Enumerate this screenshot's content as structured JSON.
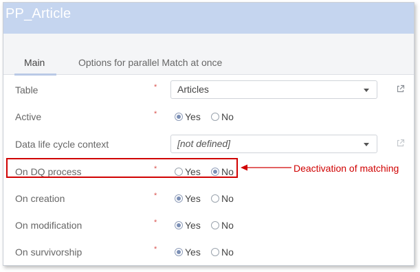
{
  "window": {
    "title": "PP_Article"
  },
  "tabs": [
    {
      "label": "Main",
      "active": true
    },
    {
      "label": "Options for parallel Match at once",
      "active": false
    }
  ],
  "required_marker": "*",
  "fields": {
    "table": {
      "label": "Table",
      "value": "Articles",
      "icon": "external-link-icon"
    },
    "active": {
      "label": "Active",
      "yes": "Yes",
      "no": "No",
      "selected": "Yes"
    },
    "dlc_context": {
      "label": "Data life cycle context",
      "value": "[not defined]",
      "icon": "external-link-icon"
    },
    "on_dq_process": {
      "label": "On DQ process",
      "yes": "Yes",
      "no": "No",
      "selected": "No"
    },
    "on_creation": {
      "label": "On creation",
      "yes": "Yes",
      "no": "No",
      "selected": "Yes"
    },
    "on_modification": {
      "label": "On modification",
      "yes": "Yes",
      "no": "No",
      "selected": "Yes"
    },
    "on_survivorship": {
      "label": "On survivorship",
      "yes": "Yes",
      "no": "No",
      "selected": "Yes"
    }
  },
  "annotation": {
    "text": "Deactivation of matching",
    "color": "#d00000"
  },
  "colors": {
    "titlebar": "#c5d5ef",
    "required": "#d9534f",
    "radio_selected": "#7b8fb5"
  }
}
